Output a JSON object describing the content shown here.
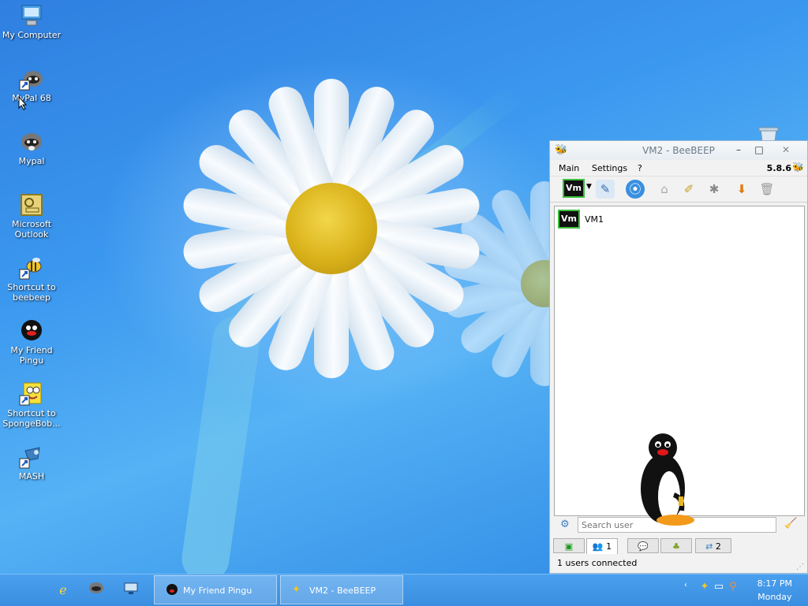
{
  "desktop": {
    "icons": [
      {
        "label": "My Computer",
        "icon": "computer-icon"
      },
      {
        "label": "MyPal 68",
        "icon": "raccoon-icon"
      },
      {
        "label": "Mypal",
        "icon": "raccoon-icon"
      },
      {
        "label": "Microsoft Outlook",
        "icon": "outlook-icon"
      },
      {
        "label": "Shortcut to beebeep",
        "icon": "bee-icon"
      },
      {
        "label": "My Friend Pingu",
        "icon": "penguin-icon"
      },
      {
        "label": "Shortcut to SpongeBob...",
        "icon": "spongebob-icon"
      },
      {
        "label": "MASH",
        "icon": "mash-icon"
      }
    ]
  },
  "window": {
    "title": "VM2 - BeeBEEP",
    "menu": [
      "Main",
      "Settings",
      "?"
    ],
    "version": "5.8.6",
    "toolbar": {
      "avatar": "Vm",
      "buttons": [
        "edit-profile-icon",
        "network-icon",
        "home-icon",
        "write-icon",
        "wand-icon",
        "download-icon",
        "trash-icon"
      ]
    },
    "users": [
      {
        "avatar": "Vm",
        "name": "VM1"
      }
    ],
    "search": {
      "placeholder": "Search user"
    },
    "tabs": [
      {
        "label": "",
        "icon": "chat-list-icon"
      },
      {
        "label": "1",
        "icon": "users-icon"
      },
      {
        "label": "",
        "icon": "chats-icon"
      },
      {
        "label": "",
        "icon": "groups-icon"
      },
      {
        "label": "2",
        "icon": "file-icon"
      }
    ],
    "status": "1 users connected"
  },
  "taskbar": {
    "quick_launch": [
      "ie-icon",
      "raccoon-icon",
      "desktop-icon"
    ],
    "tasks": [
      {
        "label": "My Friend Pingu",
        "icon": "penguin-icon"
      },
      {
        "label": "VM2 - BeeBEEP",
        "icon": "bee-icon"
      }
    ],
    "clock": {
      "time": "8:17 PM",
      "day": "Monday"
    }
  }
}
